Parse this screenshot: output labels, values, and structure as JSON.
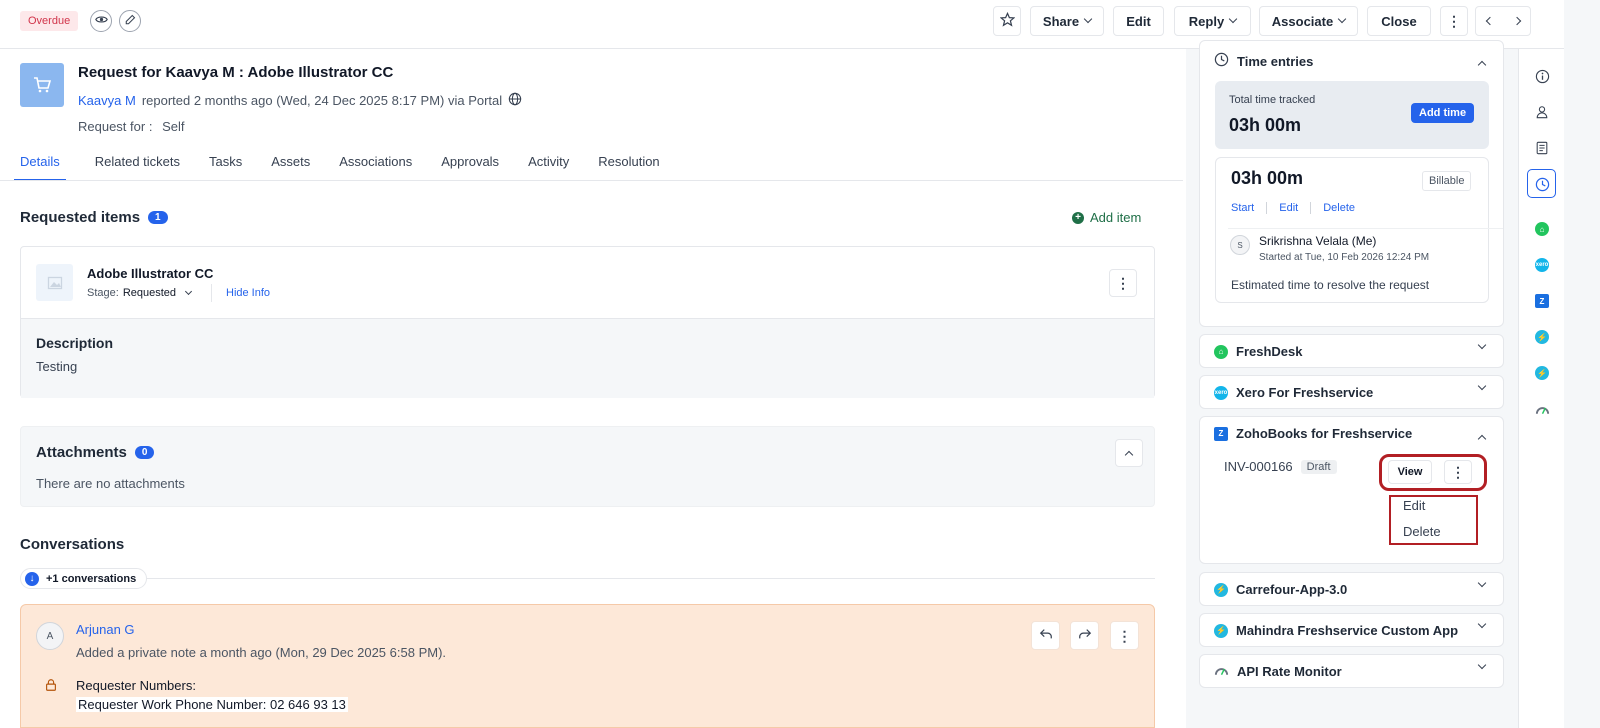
{
  "topbar": {
    "status_badge": "Overdue",
    "share": "Share",
    "edit": "Edit",
    "reply": "Reply",
    "associate": "Associate",
    "close": "Close",
    "icons": [
      "eye-icon",
      "pencil-icon",
      "star-icon",
      "more-icon",
      "chevron-left-icon",
      "chevron-right-icon"
    ]
  },
  "ticket": {
    "title": "Request for Kaavya M : Adobe Illustrator CC",
    "requester": "Kaavya M",
    "reported": "reported 2 months ago (Wed, 24 Dec 2025 8:17 PM) via Portal",
    "request_for_label": "Request for :",
    "request_for_value": "Self"
  },
  "tabs": [
    "Details",
    "Related tickets",
    "Tasks",
    "Assets",
    "Associations",
    "Approvals",
    "Activity",
    "Resolution"
  ],
  "requested_items": {
    "title": "Requested items",
    "count": "1",
    "add_item": "Add item",
    "item": {
      "name": "Adobe Illustrator CC",
      "stage_label": "Stage:",
      "stage_value": "Requested",
      "hide_info": "Hide Info",
      "description_label": "Description",
      "description_value": "Testing"
    }
  },
  "attachments": {
    "title": "Attachments",
    "count": "0",
    "empty": "There are no attachments"
  },
  "conversations": {
    "title": "Conversations",
    "more": "+1 conversations",
    "note": {
      "avatar": "A",
      "author": "Arjunan G",
      "meta": "Added a private note a month ago (Mon, 29 Dec 2025 6:58 PM).",
      "line1": "Requester Numbers:",
      "line2": "Requester Work Phone Number: 02 646 93 13"
    }
  },
  "time_entries": {
    "title": "Time entries",
    "total_label": "Total time tracked",
    "total_value": "03h 00m",
    "add_time": "Add time",
    "entry_value": "03h 00m",
    "billable": "Billable",
    "start": "Start",
    "edit": "Edit",
    "delete": "Delete",
    "user_avatar": "S",
    "user_name": "Srikrishna Velala (Me)",
    "started_at": "Started at Tue, 10 Feb 2026 12:24 PM",
    "estimate": "Estimated time to resolve the request"
  },
  "apps": {
    "freshdesk": "FreshDesk",
    "xero": "Xero For Freshservice",
    "zohobooks": "ZohoBooks for Freshservice",
    "carrefour": "Carrefour-App-3.0",
    "mahindra": "Mahindra Freshservice Custom App",
    "api_monitor": "API Rate Monitor"
  },
  "zoho": {
    "invoice": "INV-000166",
    "status": "Draft",
    "view": "View",
    "menu_edit": "Edit",
    "menu_delete": "Delete"
  },
  "colors": {
    "accent": "#2563eb",
    "overdue": "#d1344a",
    "highlight": "#b21f24",
    "note_bg": "#fde8d8"
  }
}
